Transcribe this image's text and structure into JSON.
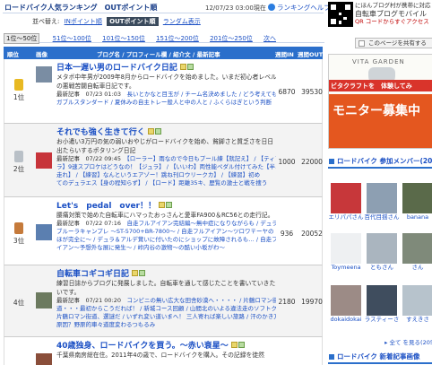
{
  "header": {
    "title": "ロードバイク人気ランキング　OUTポイント順",
    "updated": "12/07/23 03:00現在",
    "help_label": "ランキングヘルプ",
    "sort_label": "並べ替え:",
    "sort_in": "INポイント順",
    "sort_out": "OUTポイント順",
    "sort_random": "ランダム表示"
  },
  "ranges": [
    "1位〜50位",
    "51位〜100位",
    "101位〜150位",
    "151位〜200位",
    "201位〜250位",
    "次へ"
  ],
  "table": {
    "columns": [
      "順位",
      "画像",
      "ブログ名 / プロフィール欄 / 紹介文 / 最新記事",
      "週間IN",
      "週間OUT"
    ],
    "rows": [
      {
        "rank": "1位",
        "medal": "#e8b923",
        "title": "日本一遅い男のロードバイク日記",
        "desc": [
          "メタボ中年男が2009年8月からロードバイクを始めました。いまだ初心者レベル",
          "の悪戦苦闘自転車日記です。"
        ],
        "recent_date": "最新記事　07/23 01:03",
        "recent": [
          "長いとかなと目玉が / チーム名決めました / どう考えても",
          "ガブルスタンダード / 夏休みの自主トレー般人と中の人と / ふくらはぎという判断"
        ],
        "in": "6870",
        "out": "39530"
      },
      {
        "rank": "2位",
        "medal": "#b9c0c7",
        "title": "それでも強く生きて行く",
        "desc": [
          "お小遣い3万円の気の弱いおやじがロードバイクを始め、貧脚さと質乏さを日日",
          "出たらいするポタリング日記"
        ],
        "recent_date": "最新記事　07/22 09:45",
        "recent": [
          "【ローラー】雨なので今日もプール練【就記え】 / 【ティアグ",
          "ラ】9速スプロケはどうなの！【ジュラ】 / 【いいわ】両性能ペダル付けてみた【半より",
          "走れ】 / 【練習】なんというエアゾー！跳ね刊ロウリークカ】 / 【練習】初め",
          "てのデュラエス【身の程知らず】 / 【ロード】距離35キ、歴覧の激士と戦を捜う"
        ],
        "in": "1000",
        "out": "22000"
      },
      {
        "rank": "3位",
        "medal": "#c57a3b",
        "title": "Let's　pedal　over！！",
        "desc": [
          "腰痛対策で始めた自転車にハマったおっさんと愛車FA900＆RC56との走行記。"
        ],
        "recent_date": "最新記事　07/22 07:16",
        "recent": [
          "自走フルアイアン完結編〜無中症になりながらも / デュラ",
          "ブルーラキャンプレ 〜ST-5700+BR-7800〜 / 自走フルアイアン〜ツロワ〒ーヤの",
          "ほが完全に〜 / デュラ＆アルデ賞いに付いたのにショップに故障されるも… / 自走フルア",
          "イアン〜予想外な展に発生〜 / 峠内谷の激物〜の酷い小坂がわ〜"
        ],
        "in": "936",
        "out": "20052"
      },
      {
        "rank": "4位",
        "medal": "",
        "title": "自転車コギコギ日記",
        "desc": [
          "練習日誌からブログに発展しました。自転車を通して感じたことを書いていきた",
          "いです。"
        ],
        "recent_date": "最新記事　07/21 00:20",
        "recent": [
          "コンビニの無い広大な田舎砂漠へ・・・・ / 片鶴ロマン街",
          "道・・・最初からこうだれば！ / 新城コース回顧 / 山間北のいよる違法走のソフトクリーム",
          "片鶴ロマン街道、選謎だ / いずれ変い道いまへ！ 三人寄れば楽しい旅路 / 汗のかき方",
          "原因？野原的車々道度変わるつもるみ"
        ],
        "in": "2180",
        "out": "19970"
      },
      {
        "rank": "5位",
        "medal": "",
        "title": "40歳独身、ロードバイクを買う。〜赤い衰星〜",
        "desc": [
          "千葉県南房総在住。2011年4の歳で、ロードバイクを購入。その記録を徒然"
        ],
        "recent_date": "",
        "recent": [],
        "in": "",
        "out": ""
      }
    ]
  },
  "sidebar": {
    "mobile_line1": "にほんブログ村が携帯に対応",
    "mobile_line2": "自転車ブログモバイル",
    "mobile_line3": "QR コードからすぐアクセス",
    "page_button": "このページを共有する",
    "ad_brand": "VITA GARDEN",
    "ad_banner": "ビタクラフトを　体験してみ",
    "ad_main": "モニター募集中",
    "members_title": "ロードバイク 参加メンバー(205",
    "members": [
      "エリパパさん",
      "百代目揺さん",
      "banana",
      "Toymeena",
      "ともさん",
      "さん",
      "dokaidokai",
      "ラスティーさ",
      "すえきさ"
    ],
    "all_link": "▸ 全て を見る(205",
    "new_title": "ロードバイク 新着記事画像"
  }
}
